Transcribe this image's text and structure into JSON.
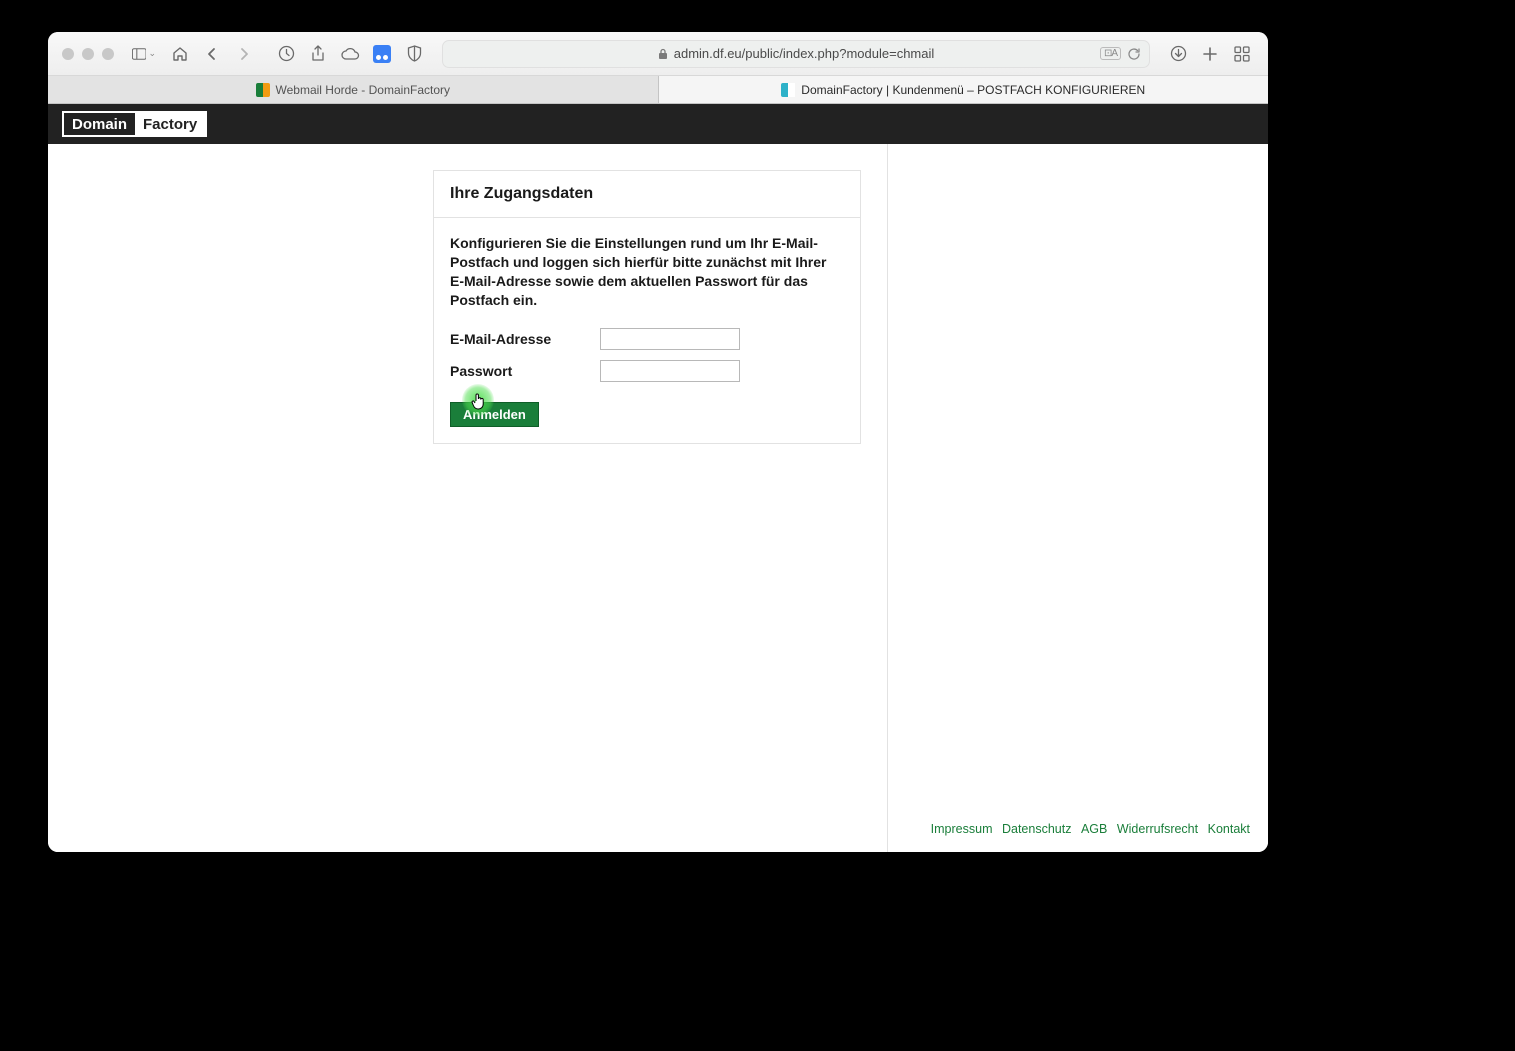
{
  "browser": {
    "url": "admin.df.eu/public/index.php?module=chmail",
    "tabs": [
      {
        "label": "Webmail Horde - DomainFactory"
      },
      {
        "label": "DomainFactory | Kundenmenü – POSTFACH KONFIGURIEREN"
      }
    ]
  },
  "logo": {
    "left": "Domain",
    "right": "Factory"
  },
  "card": {
    "title": "Ihre Zugangsdaten",
    "intro": "Konfigurieren Sie die Einstellungen rund um Ihr E-Mail-Postfach und loggen sich hierfür bitte zunächst mit Ihrer E-Mail-Adresse sowie dem aktuellen Passwort für das Postfach ein.",
    "fields": {
      "email_label": "E-Mail-Adresse",
      "email_value": "",
      "password_label": "Passwort",
      "password_value": ""
    },
    "submit": "Anmelden"
  },
  "footer": {
    "links": [
      "Impressum",
      "Datenschutz",
      "AGB",
      "Widerrufsrecht",
      "Kontakt"
    ]
  }
}
